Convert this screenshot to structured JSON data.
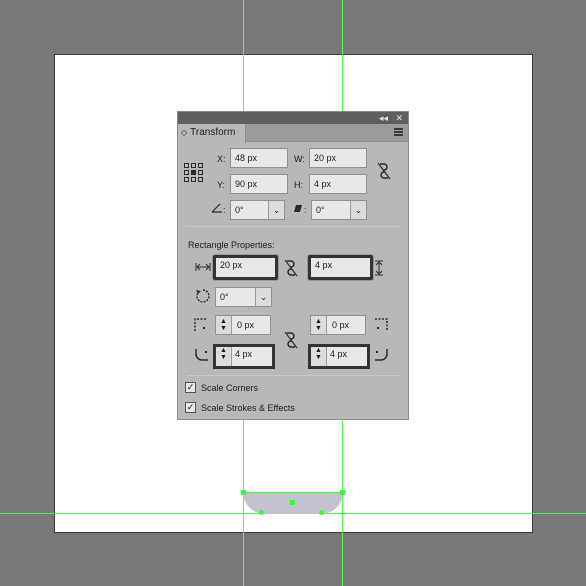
{
  "panel": {
    "tab_label": "Transform",
    "collapse_glyph": "◂◂",
    "close_glyph": "✕",
    "tab_arrow": "◇"
  },
  "transform": {
    "x_label": "X:",
    "x_value": "48 px",
    "y_label": "Y:",
    "y_value": "90 px",
    "w_label": "W:",
    "w_value": "20 px",
    "h_label": "H:",
    "h_value": "4 px",
    "angle_label": ":",
    "angle_value": "0°",
    "shear_label": ":",
    "shear_value": "0°"
  },
  "rect": {
    "section_label": "Rectangle Properties:",
    "width_value": "20 px",
    "height_value": "4 px",
    "rotate_value": "0°",
    "corner_tl": "0 px",
    "corner_tr": "0 px",
    "corner_bl": "4 px",
    "corner_br": "4 px"
  },
  "options": {
    "scale_corners_label": "Scale Corners",
    "scale_corners_checked": true,
    "scale_strokes_label": "Scale Strokes & Effects",
    "scale_strokes_checked": true
  },
  "icons": {
    "reference_point": "reference-point-icon",
    "link": "link-icon",
    "check": "✓",
    "spin": "⌃⌄",
    "dropdown": "⌄"
  },
  "colors": {
    "guide": "#4cff4c",
    "shape_fill": "#c4c2cf",
    "canvas_bg": "#787878"
  }
}
